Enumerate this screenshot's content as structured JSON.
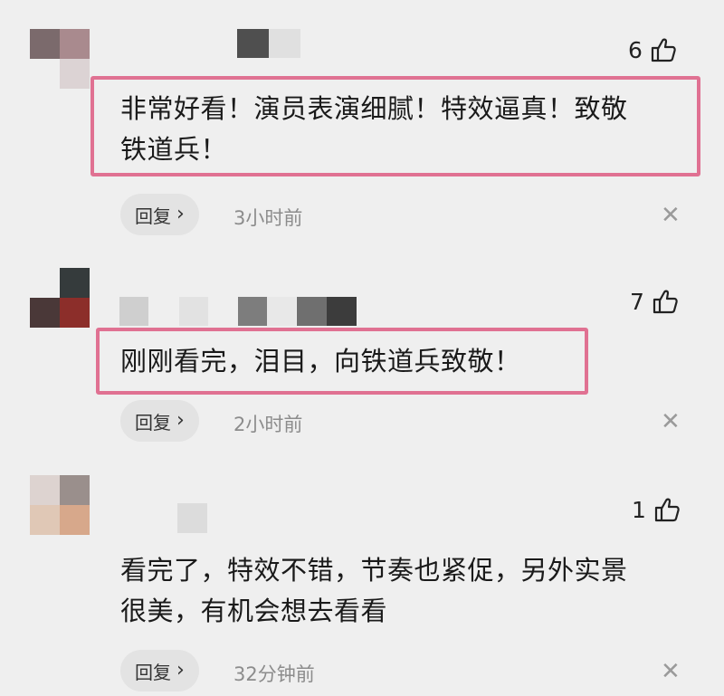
{
  "comments": [
    {
      "likes": "6",
      "text": "非常好看！演员表演细腻！特效逼真！致敬\n铁道兵！",
      "reply_label": "回复",
      "time": "3小时前",
      "highlighted": true
    },
    {
      "likes": "7",
      "text": "刚刚看完，泪目，向铁道兵致敬！",
      "reply_label": "回复",
      "time": "2小时前",
      "highlighted": true
    },
    {
      "likes": "1",
      "text": "看完了，特效不错，节奏也紧促，另外实景\n很美，有机会想去看看",
      "reply_label": "回复",
      "time": "32分钟前",
      "highlighted": false
    }
  ],
  "colors": {
    "background": "#efefef",
    "highlight_border": "#e07192",
    "reply_bg": "#e3e3e3",
    "time_text": "#8c8c8c"
  },
  "icons": {
    "like": "thumbs-up-icon",
    "close": "close-icon",
    "reply_chevron": "chevron-right-icon"
  }
}
